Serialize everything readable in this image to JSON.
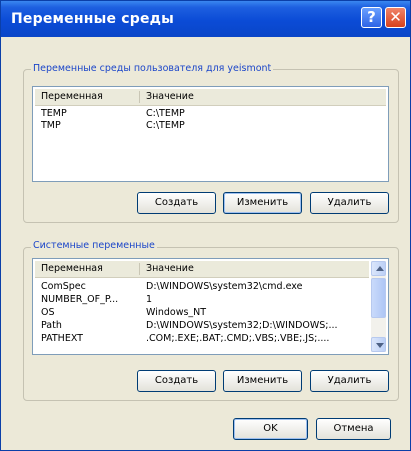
{
  "window": {
    "title": "Переменные среды",
    "help_label": "?",
    "close_label": "✕"
  },
  "user_vars": {
    "group_label": "Переменные среды пользователя для yeismont",
    "columns": [
      "Переменная",
      "Значение"
    ],
    "rows": [
      {
        "name": "TEMP",
        "value": "C:\\TEMP"
      },
      {
        "name": "TMP",
        "value": "C:\\TEMP"
      }
    ],
    "buttons": {
      "create": "Создать",
      "edit": "Изменить",
      "delete": "Удалить"
    }
  },
  "system_vars": {
    "group_label": "Системные переменные",
    "columns": [
      "Переменная",
      "Значение"
    ],
    "rows": [
      {
        "name": "ComSpec",
        "value": "D:\\WINDOWS\\system32\\cmd.exe"
      },
      {
        "name": "NUMBER_OF_P...",
        "value": "1"
      },
      {
        "name": "OS",
        "value": "Windows_NT"
      },
      {
        "name": "Path",
        "value": "D:\\WINDOWS\\system32;D:\\WINDOWS;..."
      },
      {
        "name": "PATHEXT",
        "value": ".COM;.EXE;.BAT;.CMD;.VBS;.VBE;.JS;...."
      }
    ],
    "buttons": {
      "create": "Создать",
      "edit": "Изменить",
      "delete": "Удалить"
    }
  },
  "footer": {
    "ok": "OK",
    "cancel": "Отмена"
  },
  "colors": {
    "titlebar": "#0b4bd6",
    "group_label": "#1c46c9",
    "face": "#ece9d8"
  }
}
